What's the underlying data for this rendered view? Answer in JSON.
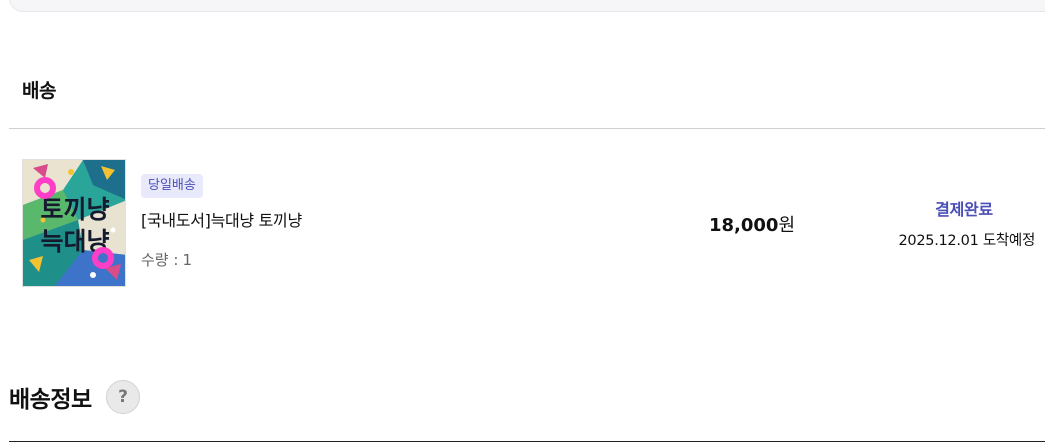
{
  "delivery": {
    "section_title": "배송",
    "item": {
      "badge": "당일배송",
      "title": "[국내도서]늑대냥 토끼냥",
      "quantity_label": "수량 :",
      "quantity_value": "1",
      "price_amount": "18,000",
      "price_unit": "원",
      "status": "결제완료",
      "arrival": "2025.12.01 도착예정",
      "cover_text_line1": "토끼냥",
      "cover_text_line2": "늑대냥"
    }
  },
  "shipping_info": {
    "title": "배송정보",
    "help_label": "?"
  },
  "colors": {
    "accent": "#4b4fb6",
    "badge_bg": "#e8e9fb"
  }
}
